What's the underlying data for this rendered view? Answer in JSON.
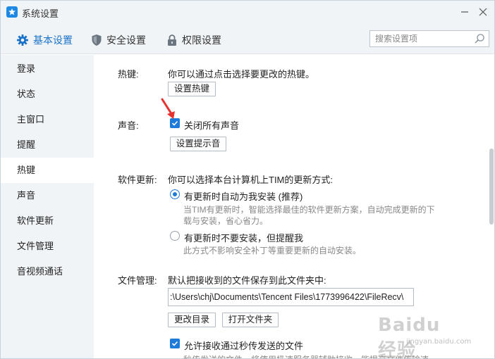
{
  "window": {
    "title": "系统设置",
    "minimize_icon": "minimize-icon",
    "close_icon": "close-icon"
  },
  "tabs": [
    {
      "label": "基本设置",
      "icon": "gear-icon",
      "active": true
    },
    {
      "label": "安全设置",
      "icon": "shield-icon",
      "active": false
    },
    {
      "label": "权限设置",
      "icon": "lock-icon",
      "active": false
    }
  ],
  "search": {
    "placeholder": "搜索设置项",
    "value": ""
  },
  "sidebar": {
    "items": [
      {
        "label": "登录"
      },
      {
        "label": "状态"
      },
      {
        "label": "主窗口"
      },
      {
        "label": "提醒"
      },
      {
        "label": "热键",
        "active": true
      },
      {
        "label": "声音"
      },
      {
        "label": "软件更新"
      },
      {
        "label": "文件管理"
      },
      {
        "label": "音视频通话"
      }
    ]
  },
  "hotkey": {
    "label": "热键:",
    "description": "你可以通过点击选择要更改的热键。",
    "button": "设置热键"
  },
  "sound": {
    "label": "声音:",
    "checkbox_label": "关闭所有声音",
    "checked": true,
    "button": "设置提示音"
  },
  "update": {
    "label": "软件更新:",
    "description": "你可以选择本台计算机上TIM的更新方式:",
    "options": [
      {
        "label": "有更新时自动为我安装 (推荐)",
        "selected": true,
        "desc_lines": [
          "当TIM有更新时，智能选择最佳的软件更新方案，自动完成更新的下",
          "载与安装，省心省力。"
        ]
      },
      {
        "label": "有更新时不要安装，但提醒我",
        "selected": false,
        "desc_lines": [
          "此方式不影响安全补丁等重要更新的自动安装。"
        ]
      }
    ]
  },
  "files": {
    "label": "文件管理:",
    "description": "默认把接收到的文件保存到此文件夹中:",
    "path": ":\\Users\\chj\\Documents\\Tencent Files\\1773996422\\FileRecv\\",
    "change_button": "更改目录",
    "open_button": "打开文件夹",
    "checkbox_label": "允许接收通过秒传发送的文件",
    "checked": true,
    "partial_desc": "秒传发送的文件，将使用极速服务器辅助接收，能提高文件传输速"
  },
  "watermark": {
    "brand": "Baidu经验",
    "site": "jingyan.baidu.com"
  },
  "colors": {
    "accent": "#1e7ad9",
    "annotation": "#e8302e",
    "sidebar_bg": "#f1f4f7"
  }
}
